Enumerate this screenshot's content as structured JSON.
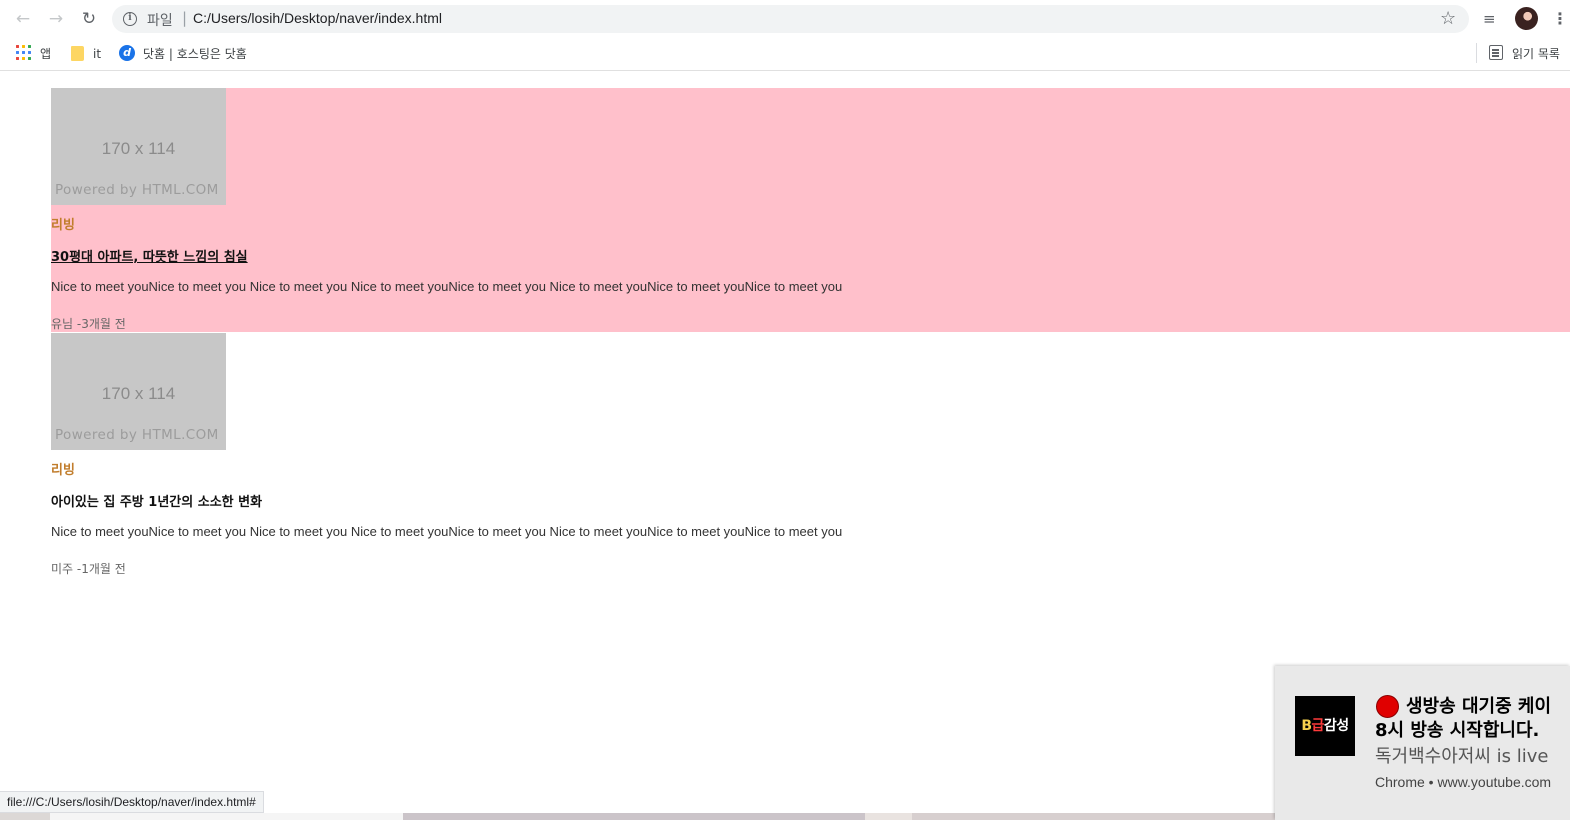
{
  "browser": {
    "url_label": "파일",
    "url_separator": "|",
    "url": "C:/Users/losih/Desktop/naver/index.html",
    "icons": [
      "back-icon",
      "forward-icon",
      "reload-icon",
      "info-icon",
      "star-icon",
      "media-control-icon",
      "profile-avatar",
      "menu-icon"
    ],
    "glyphs": {
      "back": "←",
      "forward": "→",
      "reload": "↻",
      "info": "i",
      "star": "☆",
      "media": "≡",
      "menu": "⋮"
    }
  },
  "bookmarks": {
    "apps_label": "앱",
    "folder_label": "it",
    "site_label": "닷홈 | 호스팅은 닷홈",
    "site_glyph": "d",
    "reading_list_label": "읽기 목록"
  },
  "articles": [
    {
      "thumb_size": "170 x 114",
      "thumb_powered": "Powered by HTML.COM",
      "category": "리빙",
      "title": "30평대 아파트, 따뜻한 느낌의 침실",
      "description": "Nice to meet youNice to meet you Nice to meet you Nice to meet youNice to meet you Nice to meet youNice to meet youNice to meet you",
      "meta": "유님 -3개월 전",
      "highlighted": true,
      "background": "#ffc0cb"
    },
    {
      "thumb_size": "170 x 114",
      "thumb_powered": "Powered by HTML.COM",
      "category": "리빙",
      "title": "아이있는 집 주방 1년간의 소소한 변화",
      "description": "Nice to meet youNice to meet you Nice to meet you Nice to meet youNice to meet you Nice to meet youNice to meet youNice to meet you",
      "meta": "미주 -1개월 전",
      "highlighted": false
    }
  ],
  "status_bar": {
    "text": "file:///C:/Users/losih/Desktop/naver/index.html#"
  },
  "notification": {
    "logo_b": "B",
    "logo_g": "급",
    "logo_rest": "감성",
    "title_line1": "생방송 대기중 케이",
    "title_line2": "8시 방송 시작합니다.",
    "body": "독거백수아저씨 is live",
    "source": "Chrome • www.youtube.com"
  },
  "colors": {
    "highlight": "#ffc0cb",
    "category": "#c17d2c",
    "thumb": "#c7c7c7",
    "notification_bg": "#e9e9e9"
  }
}
